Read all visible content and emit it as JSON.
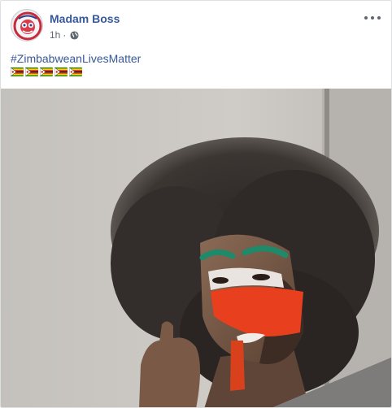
{
  "post": {
    "author": "Madam Boss",
    "time": "1h",
    "separator": "·",
    "hashtag": "#ZimbabweanLivesMatter",
    "flags": [
      "zimbabwe-flag",
      "zimbabwe-flag",
      "zimbabwe-flag",
      "zimbabwe-flag",
      "zimbabwe-flag"
    ],
    "privacy_icon": "globe-icon",
    "more_icon": "ellipsis-icon"
  },
  "colors": {
    "author": "#365899",
    "hashtag": "#385898",
    "meta": "#616770"
  }
}
